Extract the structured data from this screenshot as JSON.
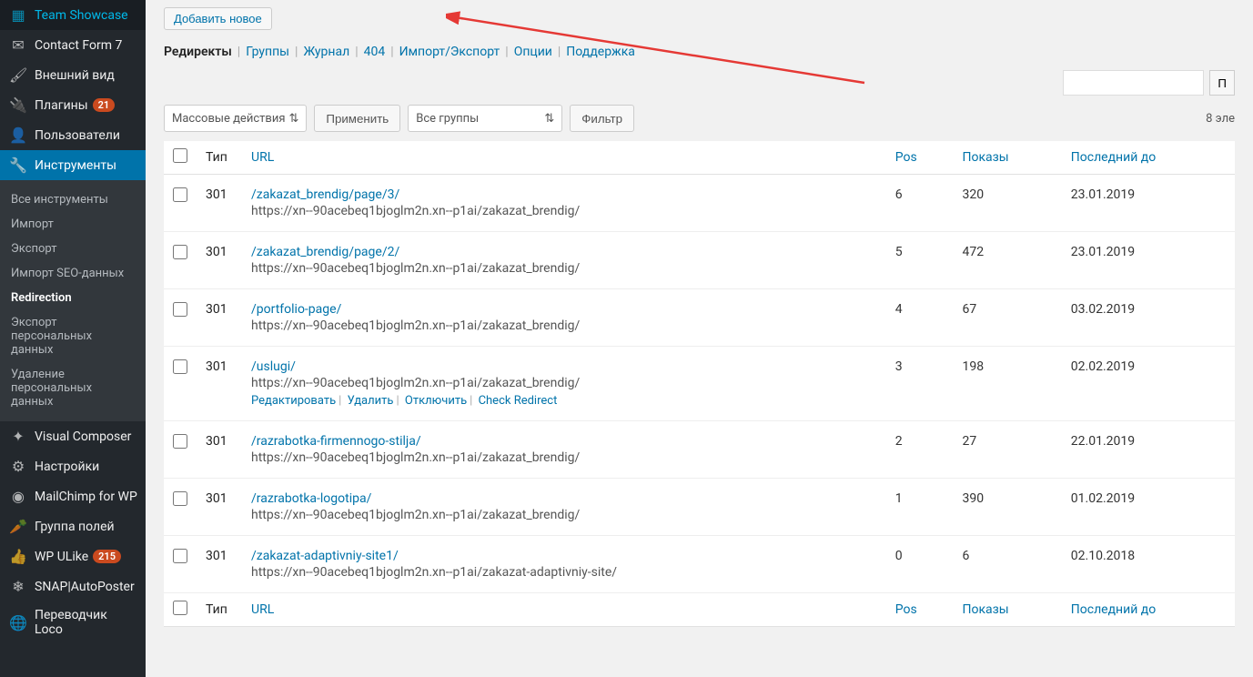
{
  "sidebar": {
    "items": [
      {
        "icon": "grid-icon",
        "label": "Team Showcase"
      },
      {
        "icon": "mail-icon",
        "label": "Contact Form 7"
      },
      {
        "icon": "brush-icon",
        "label": "Внешний вид"
      },
      {
        "icon": "plugin-icon",
        "label": "Плагины",
        "badge": "21"
      },
      {
        "icon": "user-icon",
        "label": "Пользователи"
      },
      {
        "icon": "wrench-icon",
        "label": "Инструменты",
        "active": true
      },
      {
        "icon": "vc-icon",
        "label": "Visual Composer"
      },
      {
        "icon": "sliders-icon",
        "label": "Настройки"
      },
      {
        "icon": "mc-icon",
        "label": "MailChimp for WP"
      },
      {
        "icon": "carrot-icon",
        "label": "Группа полей"
      },
      {
        "icon": "thumb-icon",
        "label": "WP ULike",
        "badge": "215"
      },
      {
        "icon": "snap-icon",
        "label": "SNAP|AutoPoster"
      },
      {
        "icon": "translate-icon",
        "label": "Переводчик Loco"
      }
    ],
    "submenu": [
      {
        "label": "Все инструменты"
      },
      {
        "label": "Импорт"
      },
      {
        "label": "Экспорт"
      },
      {
        "label": "Импорт SEO-данных"
      },
      {
        "label": "Redirection",
        "current": true
      },
      {
        "label": "Экспорт персональных данных"
      },
      {
        "label": "Удаление персональных данных"
      }
    ]
  },
  "header": {
    "add_button": "Добавить новое"
  },
  "tabs": [
    {
      "label": "Редиректы",
      "current": true
    },
    {
      "label": "Группы"
    },
    {
      "label": "Журнал"
    },
    {
      "label": "404"
    },
    {
      "label": "Импорт/Экспорт"
    },
    {
      "label": "Опции"
    },
    {
      "label": "Поддержка"
    }
  ],
  "search": {
    "button": "П"
  },
  "bulk": {
    "placeholder": "Массовые действия",
    "apply": "Применить"
  },
  "group_select": "Все группы",
  "filter_button": "Фильтр",
  "count_text": "8 эле",
  "columns": {
    "type": "Тип",
    "url": "URL",
    "pos": "Pos",
    "hits": "Показы",
    "last": "Последний до"
  },
  "rows": [
    {
      "type": "301",
      "source": "/zakazat_brendig/page/3/",
      "target": "https://xn--90acebeq1bjoglm2n.xn--p1ai/zakazat_brendig/",
      "pos": "6",
      "hits": "320",
      "date": "23.01.2019"
    },
    {
      "type": "301",
      "source": "/zakazat_brendig/page/2/",
      "target": "https://xn--90acebeq1bjoglm2n.xn--p1ai/zakazat_brendig/",
      "pos": "5",
      "hits": "472",
      "date": "23.01.2019"
    },
    {
      "type": "301",
      "source": "/portfolio-page/",
      "target": "https://xn--90acebeq1bjoglm2n.xn--p1ai/zakazat_brendig/",
      "pos": "4",
      "hits": "67",
      "date": "03.02.2019"
    },
    {
      "type": "301",
      "source": "/uslugi/",
      "target": "https://xn--90acebeq1bjoglm2n.xn--p1ai/zakazat_brendig/",
      "pos": "3",
      "hits": "198",
      "date": "02.02.2019",
      "actions": true
    },
    {
      "type": "301",
      "source": "/razrabotka-firmennogo-stilja/",
      "target": "https://xn--90acebeq1bjoglm2n.xn--p1ai/zakazat_brendig/",
      "pos": "2",
      "hits": "27",
      "date": "22.01.2019"
    },
    {
      "type": "301",
      "source": "/razrabotka-logotipa/",
      "target": "https://xn--90acebeq1bjoglm2n.xn--p1ai/zakazat_brendig/",
      "pos": "1",
      "hits": "390",
      "date": "01.02.2019"
    },
    {
      "type": "301",
      "source": "/zakazat-adaptivniy-site1/",
      "target": "https://xn--90acebeq1bjoglm2n.xn--p1ai/zakazat-adaptivniy-site/",
      "pos": "0",
      "hits": "6",
      "date": "02.10.2018"
    }
  ],
  "row_actions": {
    "edit": "Редактировать",
    "delete": "Удалить",
    "disable": "Отключить",
    "check": "Check Redirect"
  }
}
